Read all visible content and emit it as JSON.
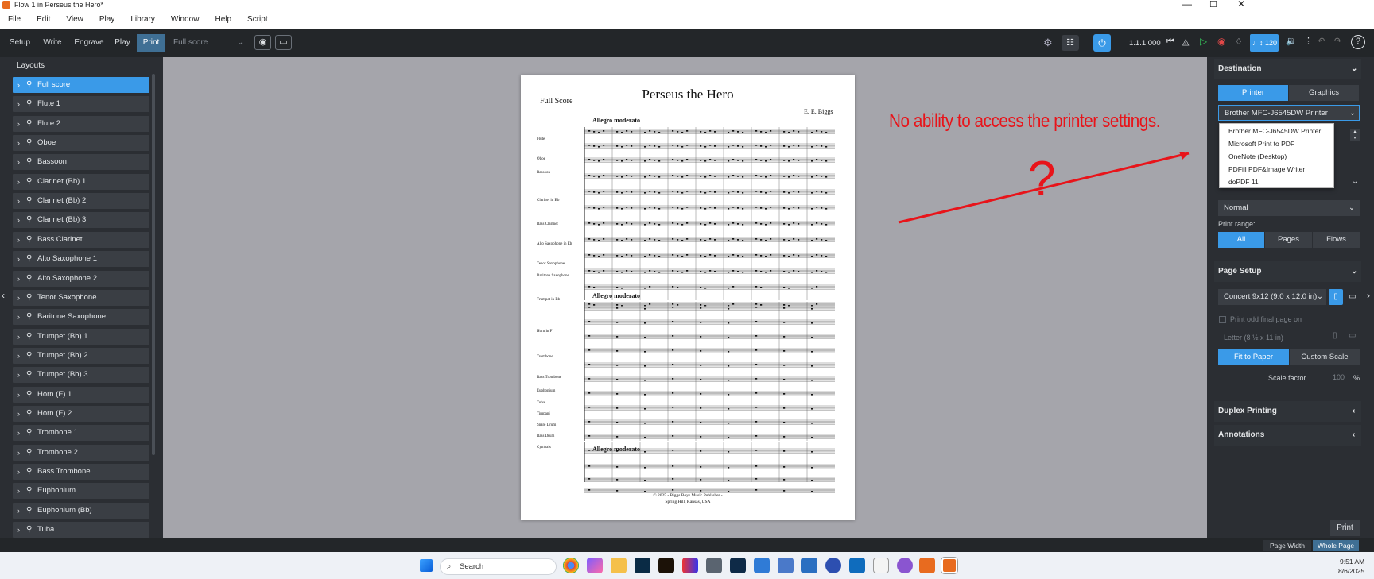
{
  "window": {
    "title": "Flow 1 in Perseus the Hero*",
    "app_icon": "dorico-icon"
  },
  "menu": [
    "File",
    "Edit",
    "View",
    "Play",
    "Library",
    "Window",
    "Help",
    "Script"
  ],
  "modes": [
    "Setup",
    "Write",
    "Engrave",
    "Play",
    "Print"
  ],
  "active_mode": "Print",
  "layout_select": "Full score",
  "transport": {
    "position": "1.1.1.000",
    "tempo": "120"
  },
  "left_panel": {
    "title": "Layouts",
    "items": [
      "Full score",
      "Flute 1",
      "Flute 2",
      "Oboe",
      "Bassoon",
      "Clarinet (Bb) 1",
      "Clarinet (Bb) 2",
      "Clarinet (Bb) 3",
      "Bass Clarinet",
      "Alto Saxophone 1",
      "Alto Saxophone 2",
      "Tenor Saxophone",
      "Baritone Saxophone",
      "Trumpet (Bb) 1",
      "Trumpet (Bb) 2",
      "Trumpet (Bb) 3",
      "Horn (F) 1",
      "Horn (F) 2",
      "Trombone 1",
      "Trombone 2",
      "Bass Trombone",
      "Euphonium",
      "Euphonium (Bb)",
      "Tuba"
    ]
  },
  "score": {
    "label": "Full Score",
    "title": "Perseus the Hero",
    "composer": "E. E. Biggs",
    "tempo_marking": "Allegro moderato",
    "instruments": [
      "Flute",
      "Oboe",
      "Bassoon",
      "Clarinet in Bb",
      "Bass Clarinet",
      "Alto Saxophone in Eb",
      "Tenor Saxophone",
      "Baritone Saxophone",
      "Trumpet in Bb",
      "Horn in F",
      "Trombone",
      "Bass Trombone",
      "Euphonium",
      "Tuba",
      "Timpani",
      "Snare Drum",
      "Bass Drum",
      "Cymbals"
    ],
    "footer1": "© 2025 - Biggs Boys Music Publisher -",
    "footer2": "Spring Hill, Kansas, USA"
  },
  "annotation": {
    "text": "No ability to access the printer settings.",
    "mark": "?",
    "color": "#e8141a"
  },
  "right_panel": {
    "destination": "Destination",
    "dest_tabs": [
      "Printer",
      "Graphics"
    ],
    "printer_selected": "Brother MFC-J6545DW Printer",
    "printer_options": [
      "Brother MFC-J6545DW Printer",
      "Microsoft Print to PDF",
      "OneNote (Desktop)",
      "PDFill PDF&Image Writer",
      "doPDF 11"
    ],
    "job_type": "Normal",
    "print_range_label": "Print range:",
    "range_tabs": [
      "All",
      "Pages",
      "Flows"
    ],
    "page_setup": "Page Setup",
    "paper_size": "Concert 9x12 (9.0 x 12.0 in)",
    "print_odd": "Print odd final page on",
    "letter": "Letter (8 ½ x 11 in)",
    "scale_tabs": [
      "Fit to Paper",
      "Custom Scale"
    ],
    "scale_factor_label": "Scale factor",
    "scale_factor_value": "100",
    "scale_unit": "%",
    "duplex": "Duplex Printing",
    "annotations": "Annotations",
    "print_button": "Print"
  },
  "status": {
    "zoom_options": [
      "Page Width",
      "Whole Page"
    ],
    "active_zoom": "Whole Page"
  },
  "taskbar": {
    "search_placeholder": "Search",
    "time": "9:51 AM",
    "date": "8/6/2025"
  },
  "accent": "#3a9ae8"
}
